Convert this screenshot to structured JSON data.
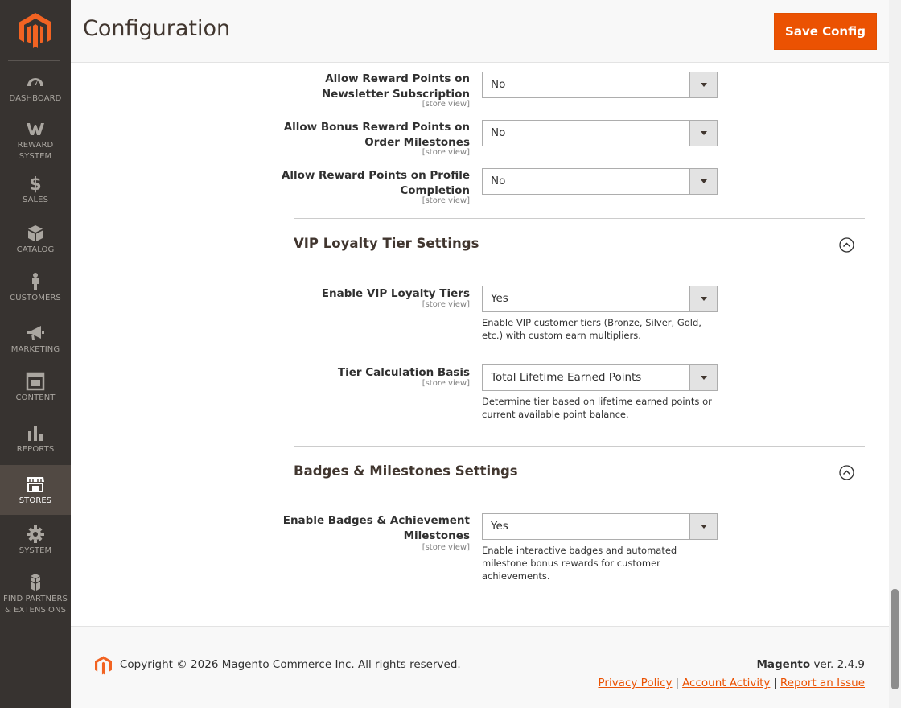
{
  "header": {
    "title": "Configuration",
    "save_label": "Save Config"
  },
  "sidebar": {
    "items": [
      {
        "label": "DASHBOARD",
        "icon": "dashboard-icon"
      },
      {
        "label": "REWARD SYSTEM",
        "icon": "reward-system-icon"
      },
      {
        "label": "SALES",
        "icon": "dollar-icon"
      },
      {
        "label": "CATALOG",
        "icon": "box-icon"
      },
      {
        "label": "CUSTOMERS",
        "icon": "person-icon"
      },
      {
        "label": "MARKETING",
        "icon": "megaphone-icon"
      },
      {
        "label": "CONTENT",
        "icon": "layout-icon"
      },
      {
        "label": "REPORTS",
        "icon": "bar-chart-icon"
      },
      {
        "label": "STORES",
        "icon": "storefront-icon"
      },
      {
        "label": "SYSTEM",
        "icon": "gear-icon"
      },
      {
        "label": "FIND PARTNERS & EXTENSIONS",
        "icon": "cubes-icon"
      }
    ],
    "active": "STORES"
  },
  "fields": {
    "newsletter": {
      "label": "Allow Reward Points on Newsletter Subscription",
      "scope": "[store view]",
      "value": "No"
    },
    "milestones": {
      "label": "Allow Bonus Reward Points on Order Milestones",
      "scope": "[store view]",
      "value": "No"
    },
    "profile": {
      "label": "Allow Reward Points on Profile Completion",
      "scope": "[store view]",
      "value": "No"
    },
    "vip_enable": {
      "label": "Enable VIP Loyalty Tiers",
      "scope": "[store view]",
      "value": "Yes",
      "note": "Enable VIP customer tiers (Bronze, Silver, Gold, etc.) with custom earn multipliers."
    },
    "tier_basis": {
      "label": "Tier Calculation Basis",
      "scope": "[store view]",
      "value": "Total Lifetime Earned Points",
      "note": "Determine tier based on lifetime earned points or current available point balance."
    },
    "badges_enable": {
      "label": "Enable Badges & Achievement Milestones",
      "scope": "[store view]",
      "value": "Yes",
      "note": "Enable interactive badges and automated milestone bonus rewards for customer achievements."
    }
  },
  "sections": {
    "vip": "VIP Loyalty Tier Settings",
    "badges": "Badges & Milestones Settings"
  },
  "footer": {
    "copyright": "Copyright © 2026 Magento Commerce Inc. All rights reserved.",
    "brand": "Magento",
    "version": " ver. 2.4.9",
    "links": {
      "privacy": "Privacy Policy",
      "activity": "Account Activity",
      "issue": "Report an Issue"
    },
    "separator": "|"
  },
  "colors": {
    "accent": "#eb5202",
    "sidebar_bg": "#373330",
    "sidebar_active": "#514943"
  }
}
